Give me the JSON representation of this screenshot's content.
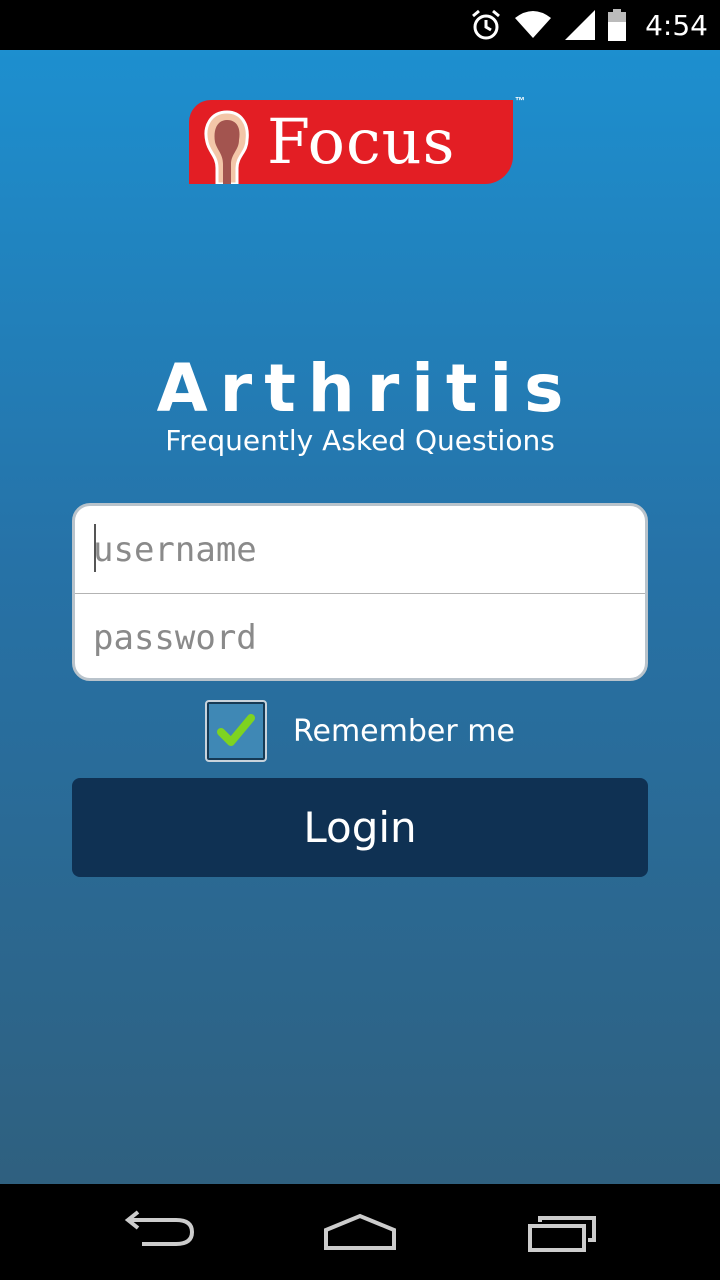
{
  "status_bar": {
    "time": "4:54",
    "icons": [
      "alarm-icon",
      "wifi-icon",
      "signal-icon",
      "battery-icon"
    ]
  },
  "logo": {
    "text": "Focus",
    "trademark": "™",
    "brand_color": "#e31e24"
  },
  "header": {
    "title": "Arthritis",
    "subtitle": "Frequently Asked Questions"
  },
  "form": {
    "username": {
      "value": "",
      "placeholder": "username"
    },
    "password": {
      "value": "",
      "placeholder": "password"
    },
    "remember_me": {
      "label": "Remember me",
      "checked": true
    },
    "login_label": "Login"
  },
  "colors": {
    "background_top": "#1d8fcf",
    "background_bottom": "#2f607f",
    "button": "#0f3153",
    "check": "#7ed321"
  },
  "nav_bar": {
    "icons": [
      "back-icon",
      "home-icon",
      "recent-apps-icon"
    ]
  }
}
